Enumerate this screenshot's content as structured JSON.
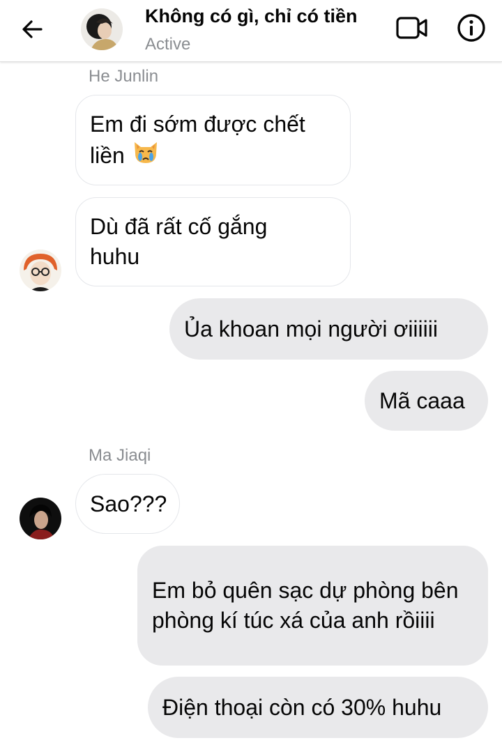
{
  "header": {
    "title": "Không có gì, chỉ có tiền",
    "status": "Active",
    "icons": [
      "back-arrow-icon",
      "video-call-icon",
      "info-icon"
    ]
  },
  "messages": [
    {
      "sender": "He Junlin",
      "direction": "incoming",
      "text": "Em đi sớm được chết liền",
      "emoji": "crying-cat-face"
    },
    {
      "sender": "He Junlin",
      "direction": "incoming",
      "text": "Dù đã rất cố gắng huhu"
    },
    {
      "direction": "outgoing",
      "text": "Ủa khoan mọi người ơiiiiii"
    },
    {
      "direction": "outgoing",
      "text": "Mã caaa"
    },
    {
      "sender": "Ma Jiaqi",
      "direction": "incoming",
      "text": "Sao???"
    },
    {
      "direction": "outgoing",
      "text": "Em bỏ quên sạc dự phòng bên phòng kí túc xá của anh rồiiii"
    },
    {
      "direction": "outgoing",
      "text": "Điện thoại còn có 30% huhu"
    }
  ],
  "colors": {
    "outgoing_bubble": "#e9e9eb",
    "incoming_bubble": "#ffffff",
    "secondary_text": "#8a8d91"
  }
}
